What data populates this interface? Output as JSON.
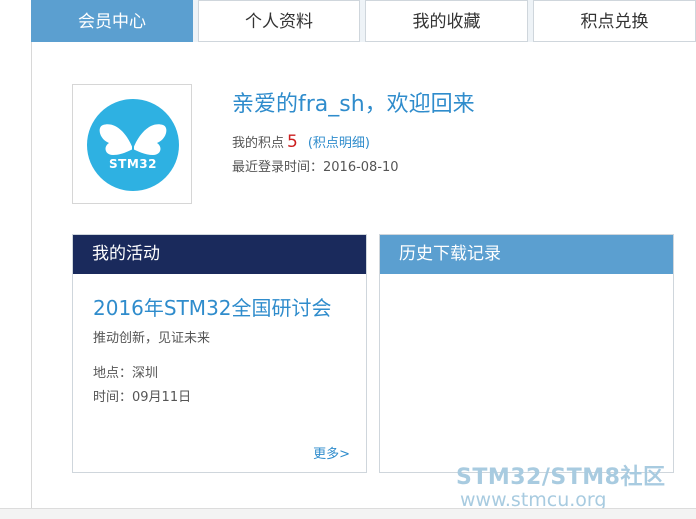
{
  "tabs": [
    {
      "label": "会员中心",
      "active": true
    },
    {
      "label": "个人资料",
      "active": false
    },
    {
      "label": "我的收藏",
      "active": false
    },
    {
      "label": "积点兑换",
      "active": false
    }
  ],
  "profile": {
    "avatar_text": "STM32",
    "welcome": "亲爱的fra_sh，欢迎回来",
    "points_label": "我的积点",
    "points_value": "5",
    "points_detail_link": "(积点明细)",
    "last_login": "最近登录时间：2016-08-10"
  },
  "activity": {
    "header": "我的活动",
    "event_title": "2016年STM32全国研讨会",
    "slogan": "推动创新，见证未来",
    "place": "地点：深圳",
    "time": "时间：09月11日",
    "more": "更多>"
  },
  "history": {
    "header": "历史下载记录"
  },
  "watermark": {
    "line1": "STM32/STM8社区",
    "line2": "www.stmcu.org"
  },
  "colors": {
    "tab_active": "#5b9fd0",
    "activity_header": "#1a2a5c",
    "history_header": "#5b9fd0",
    "link": "#2f8ccc",
    "points_value": "#cc1f1f",
    "avatar_bg": "#2eb1e2"
  }
}
